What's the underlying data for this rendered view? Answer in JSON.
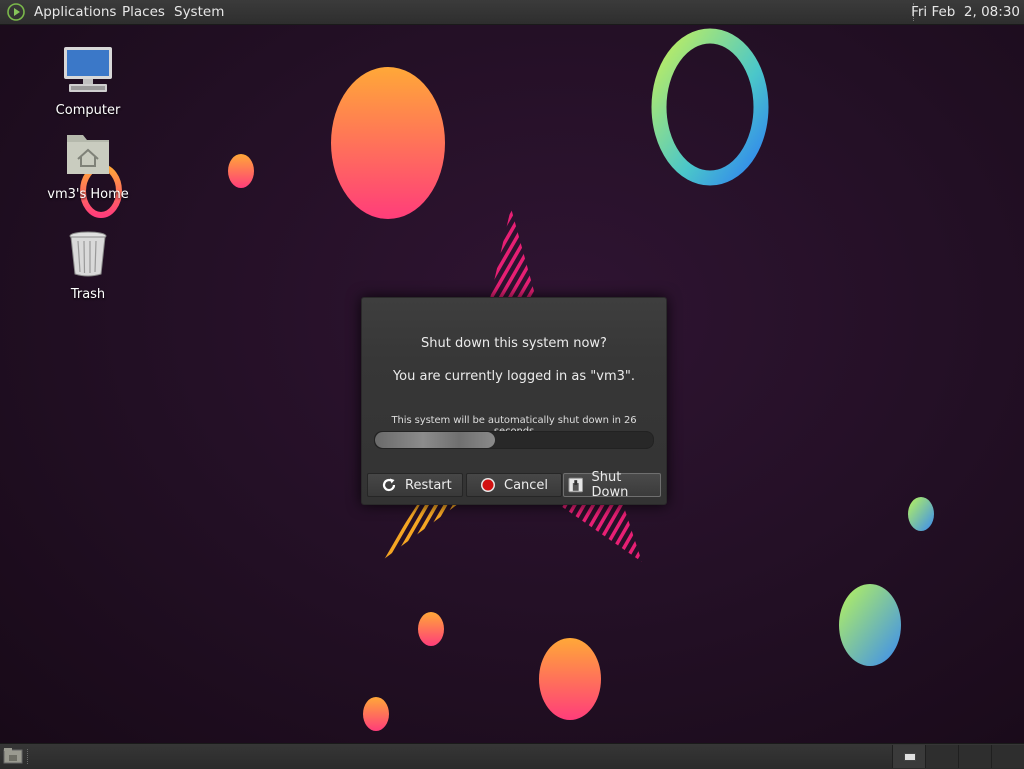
{
  "top_panel": {
    "menus": [
      "Applications",
      "Places",
      "System"
    ],
    "clock": "Fri Feb  2, 08:30"
  },
  "desktop_icons": [
    {
      "label": "Computer",
      "icon": "computer-icon"
    },
    {
      "label": "vm3's Home",
      "icon": "home-folder-icon"
    },
    {
      "label": "Trash",
      "icon": "trash-icon"
    }
  ],
  "dialog": {
    "title": "Shut down this system now?",
    "logged_in": "You are currently logged in as \"vm3\".",
    "countdown": "This system will be automatically shut down in 26 seconds",
    "progress_fraction": 0.43,
    "buttons": {
      "restart": "Restart",
      "cancel": "Cancel",
      "shutdown": "Shut Down"
    }
  },
  "colors": {
    "panel": "#333333",
    "desktop_bg": "#220f24",
    "dialog_bg": "#383838",
    "cancel_red": "#d21010"
  }
}
